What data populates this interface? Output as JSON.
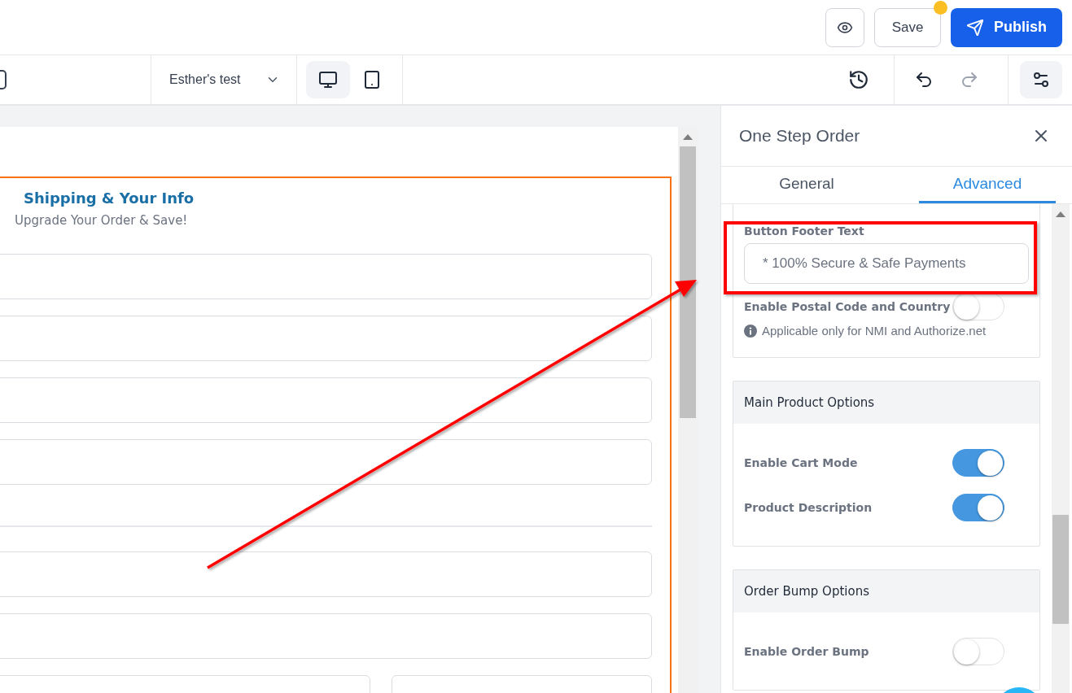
{
  "header": {
    "save": {
      "label": "Save",
      "unsaved": true
    },
    "publish": {
      "label": "Publish"
    }
  },
  "toolbar": {
    "page_selector": {
      "value": "Esther's test"
    },
    "devices": [
      {
        "kind": "desktop",
        "selected": true
      },
      {
        "kind": "tablet",
        "selected": false
      }
    ],
    "undo": {
      "disabled": false
    },
    "redo": {
      "disabled": true
    }
  },
  "canvas": {
    "section": {
      "title": "Shipping & Your Info",
      "subtitle": "Upgrade Your Order & Save!"
    }
  },
  "panel": {
    "title": "One Step Order",
    "tabs": [
      {
        "label": "General",
        "selected": false
      },
      {
        "label": "Advanced",
        "selected": true
      }
    ],
    "cards": [
      {
        "rows": [
          {
            "kind": "text",
            "label": "Button Footer Text",
            "value": "* 100% Secure & Safe Payments",
            "highlighted": true
          },
          {
            "kind": "toggle",
            "label": "Enable Postal Code and Country",
            "on": false,
            "note": "Applicable only for NMI and Authorize.net"
          }
        ]
      },
      {
        "title": "Main Product Options",
        "rows": [
          {
            "kind": "toggle",
            "label": "Enable Cart Mode",
            "on": true
          },
          {
            "kind": "toggle",
            "label": "Product Description",
            "on": true
          }
        ]
      },
      {
        "title": "Order Bump Options",
        "rows": [
          {
            "kind": "toggle",
            "label": "Enable Order Bump",
            "on": false
          }
        ]
      }
    ]
  }
}
